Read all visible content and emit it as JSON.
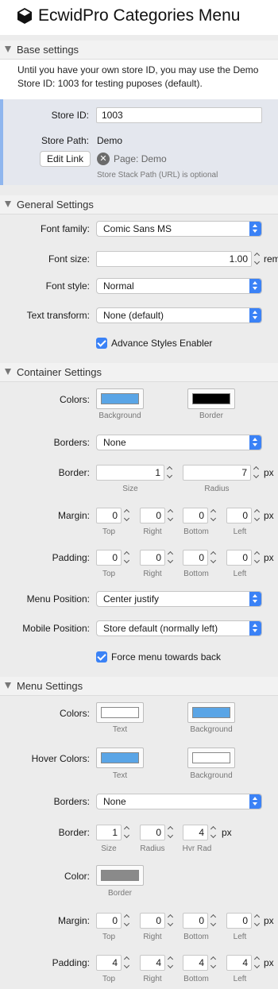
{
  "app": {
    "title": "EcwidPro Categories Menu",
    "icon": "box-icon"
  },
  "base": {
    "heading": "Base settings",
    "note": "Until you have your own store ID, you may use the Demo Store ID: 1003 for testing puposes (default).",
    "store_id_label": "Store ID:",
    "store_id_value": "1003",
    "store_path_label": "Store Path:",
    "store_path_value": "Demo",
    "edit_link_label": "Edit Link",
    "page_label": "Page: Demo",
    "path_hint": "Store Stack Path (URL) is optional"
  },
  "general": {
    "heading": "General Settings",
    "font_family_label": "Font family:",
    "font_family_value": "Comic Sans MS",
    "font_size_label": "Font size:",
    "font_size_value": "1.00",
    "font_size_unit": "rem",
    "font_style_label": "Font style:",
    "font_style_value": "Normal",
    "text_transform_label": "Text transform:",
    "text_transform_value": "None (default)",
    "advance_styles_label": "Advance Styles Enabler",
    "advance_styles_checked": true
  },
  "container": {
    "heading": "Container Settings",
    "colors_label": "Colors:",
    "background_color": "#5aa5e6",
    "background_caption": "Background",
    "border_color": "#000000",
    "border_caption": "Border",
    "borders_label": "Borders:",
    "borders_value": "None",
    "border_label": "Border:",
    "border_size": "1",
    "border_size_caption": "Size",
    "border_radius": "7",
    "border_radius_caption": "Radius",
    "border_unit": "px",
    "margin_label": "Margin:",
    "margin": [
      "0",
      "0",
      "0",
      "0"
    ],
    "padding_label": "Padding:",
    "padding": [
      "0",
      "0",
      "0",
      "0"
    ],
    "sides": [
      "Top",
      "Right",
      "Bottom",
      "Left"
    ],
    "px": "px",
    "menu_position_label": "Menu Position:",
    "menu_position_value": "Center justify",
    "mobile_position_label": "Mobile Position:",
    "mobile_position_value": "Store default (normally left)",
    "force_back_label": "Force menu towards back",
    "force_back_checked": true
  },
  "menu": {
    "heading": "Menu Settings",
    "colors_label": "Colors:",
    "text_color": "#ffffff",
    "text_caption": "Text",
    "background_color": "#5aa5e6",
    "background_caption": "Background",
    "hover_colors_label": "Hover Colors:",
    "hover_text_color": "#5aa5e6",
    "hover_text_caption": "Text",
    "hover_background_color": "#ffffff",
    "hover_background_caption": "Background",
    "borders_label": "Borders:",
    "borders_value": "None",
    "border_label": "Border:",
    "border_size": "1",
    "border_size_caption": "Size",
    "border_radius": "0",
    "border_radius_caption": "Radius",
    "border_hvr_rad": "4",
    "border_hvr_rad_caption": "Hvr Rad",
    "border_unit": "px",
    "color_label": "Color:",
    "border_color": "#8a8a8a",
    "border_color_caption": "Border",
    "margin_label": "Margin:",
    "margin": [
      "0",
      "0",
      "0",
      "0"
    ],
    "padding_label": "Padding:",
    "padding": [
      "4",
      "4",
      "4",
      "4"
    ],
    "sides": [
      "Top",
      "Right",
      "Bottom",
      "Left"
    ],
    "px": "px"
  }
}
